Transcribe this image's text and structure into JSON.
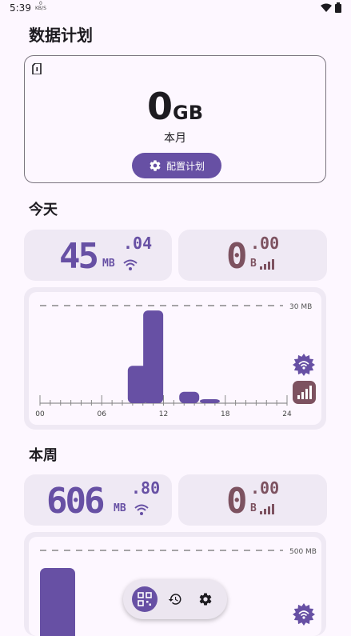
{
  "status_bar": {
    "time": "5:39",
    "speed_value": "0",
    "speed_unit": "KB/S"
  },
  "page_title": "数据计划",
  "plan": {
    "usage_value": "0",
    "usage_unit": "GB",
    "period_label": "本月",
    "config_button_label": "配置计划"
  },
  "today": {
    "section_title": "今天",
    "wifi_usage": {
      "integer": "45",
      "decimal": ".04",
      "unit": "MB"
    },
    "mobile_usage": {
      "integer": "0",
      "decimal": ".00",
      "unit": "B"
    },
    "chart_data": {
      "type": "bar",
      "x_ticks": [
        "00",
        "06",
        "12",
        "18",
        "24"
      ],
      "max_label": "30 MB",
      "series": [
        {
          "values": [
            {
              "x": 9.5,
              "y": 11
            },
            {
              "x": 11,
              "y": 28
            },
            {
              "x": 14.5,
              "y": 3
            },
            {
              "x": 16.5,
              "y": 0.5
            }
          ]
        }
      ],
      "grid": false
    }
  },
  "week": {
    "section_title": "本周",
    "wifi_usage": {
      "integer": "606",
      "decimal": ".80",
      "unit": "MB"
    },
    "mobile_usage": {
      "integer": "0",
      "decimal": ".00",
      "unit": "B"
    },
    "chart_data": {
      "type": "bar",
      "max_label": "500 MB",
      "series": [
        {
          "values": [
            {
              "x": 0,
              "y": 480
            }
          ]
        }
      ]
    }
  },
  "colors": {
    "primary": "#6750a4",
    "mobile": "#7d5260",
    "card_bg": "#efe9f4"
  },
  "nav": {
    "items": [
      "dashboard-icon",
      "history-icon",
      "settings-icon"
    ]
  }
}
